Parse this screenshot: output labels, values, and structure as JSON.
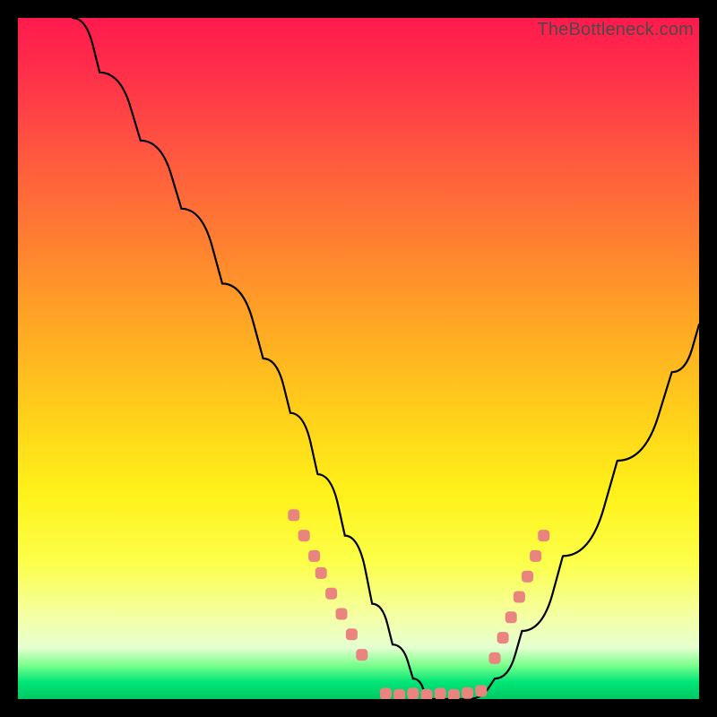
{
  "watermark": "TheBottleneck.com",
  "chart_data": {
    "type": "line",
    "title": "",
    "xlabel": "",
    "ylabel": "",
    "xlim": [
      0,
      100
    ],
    "ylim": [
      0,
      100
    ],
    "series": [
      {
        "name": "bottleneck-curve",
        "x": [
          8,
          12,
          18,
          24,
          30,
          36,
          40,
          44,
          48,
          52,
          55,
          58,
          60,
          63,
          66,
          70,
          74,
          80,
          88,
          96,
          100
        ],
        "y": [
          100,
          92,
          82,
          72,
          61,
          50,
          42,
          33,
          24,
          14,
          8,
          3,
          0,
          0,
          0,
          3,
          10,
          21,
          35,
          48,
          55
        ]
      }
    ],
    "markers": {
      "left_cluster": {
        "x": [
          40.5,
          42,
          43.5,
          44.5,
          46,
          47.5,
          49,
          50.5
        ],
        "y": [
          27,
          24,
          21,
          18.5,
          15.5,
          12.5,
          9.5,
          6.5
        ]
      },
      "valley_cluster": {
        "x": [
          54,
          56,
          58,
          60,
          62,
          64,
          66,
          68
        ],
        "y": [
          0.8,
          0.6,
          0.8,
          0.6,
          0.8,
          0.6,
          0.9,
          1.2
        ]
      },
      "right_cluster": {
        "x": [
          70,
          71.2,
          72.4,
          73.6,
          74.8,
          76,
          77.2
        ],
        "y": [
          6,
          9,
          12,
          15,
          18,
          21,
          24
        ]
      }
    },
    "gradient_stops": [
      {
        "pos": 0,
        "color": "#ff1a4d"
      },
      {
        "pos": 0.2,
        "color": "#ff5740"
      },
      {
        "pos": 0.45,
        "color": "#ffa724"
      },
      {
        "pos": 0.7,
        "color": "#fff21a"
      },
      {
        "pos": 0.88,
        "color": "#f4ffa6"
      },
      {
        "pos": 0.95,
        "color": "#7cff8c"
      },
      {
        "pos": 1.0,
        "color": "#00c864"
      }
    ],
    "marker_color": "#e9847f",
    "curve_color": "#000000"
  }
}
